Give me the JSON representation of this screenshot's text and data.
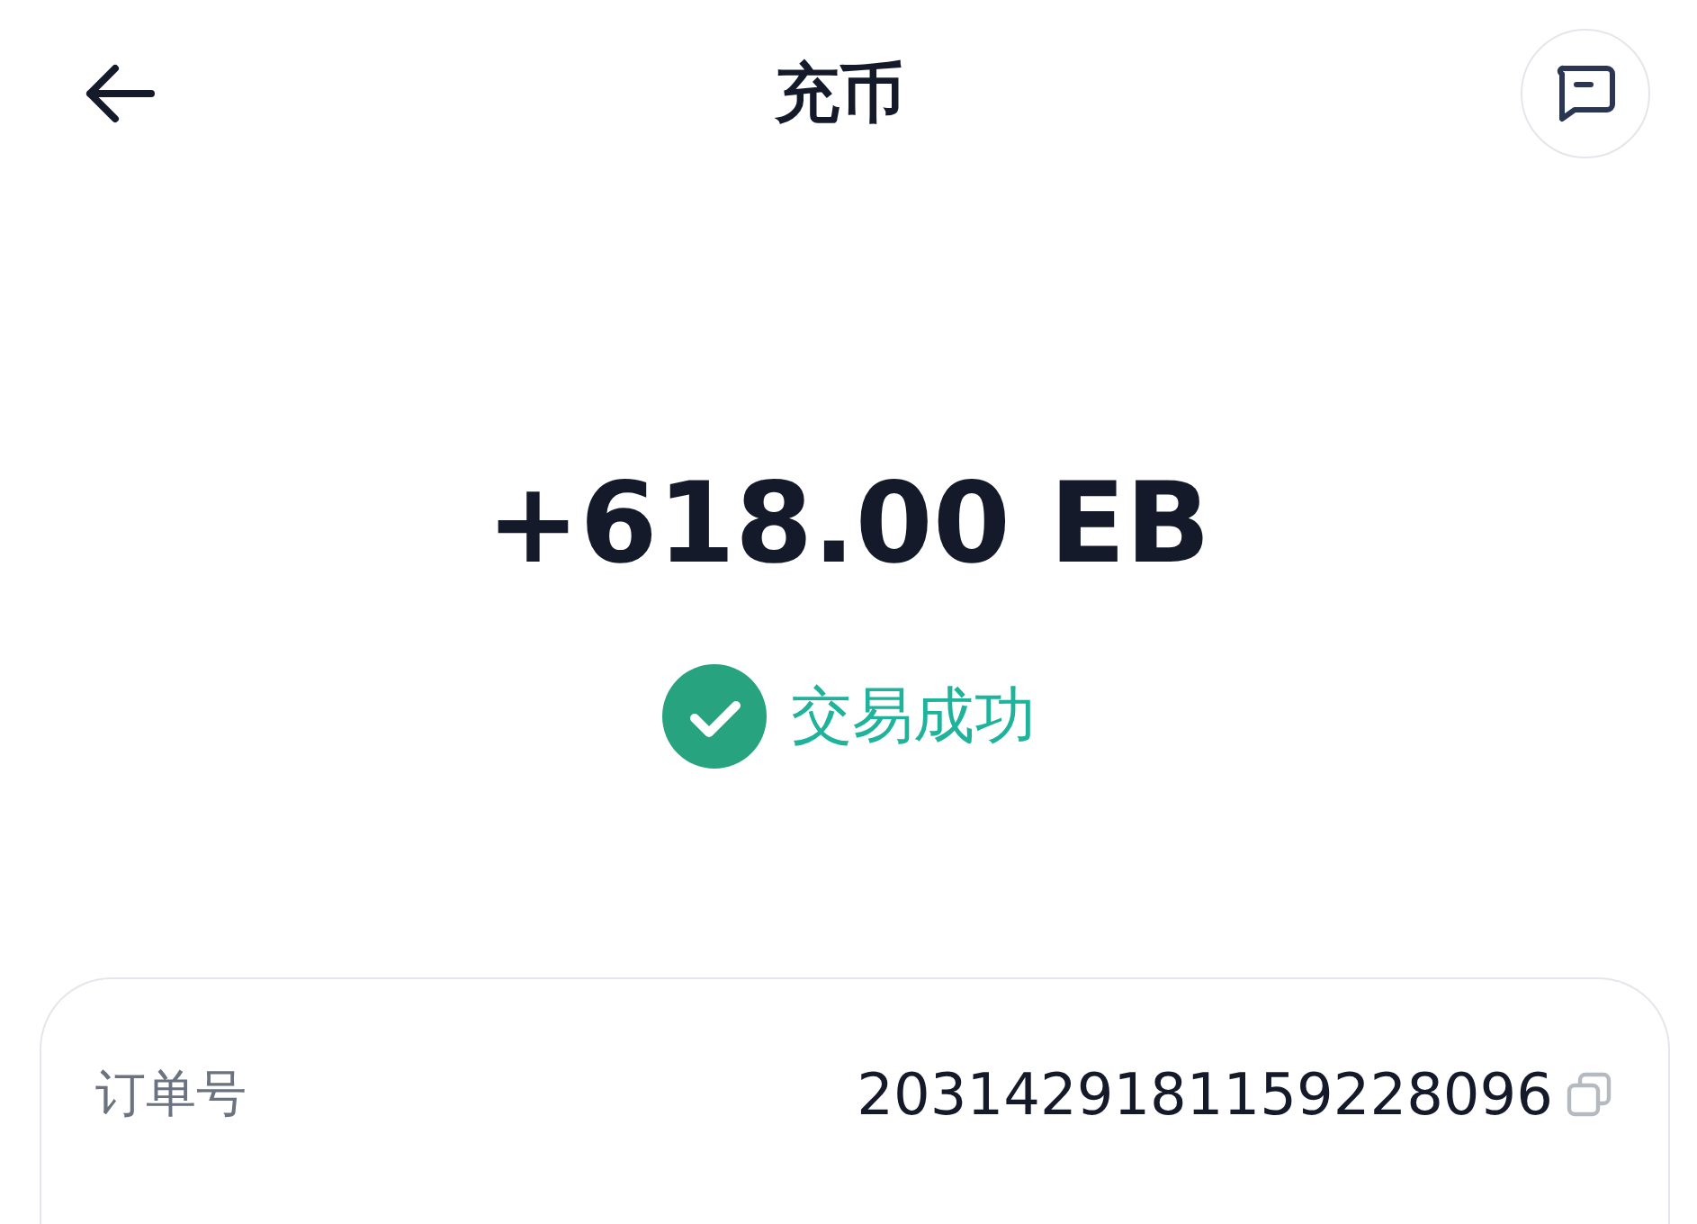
{
  "header": {
    "title": "充币"
  },
  "amount": "+618.00 EB",
  "status": {
    "kind": "success",
    "label": "交易成功"
  },
  "details": [
    {
      "label": "订单号",
      "value": "2031429181159228096",
      "copyable": true
    }
  ]
}
